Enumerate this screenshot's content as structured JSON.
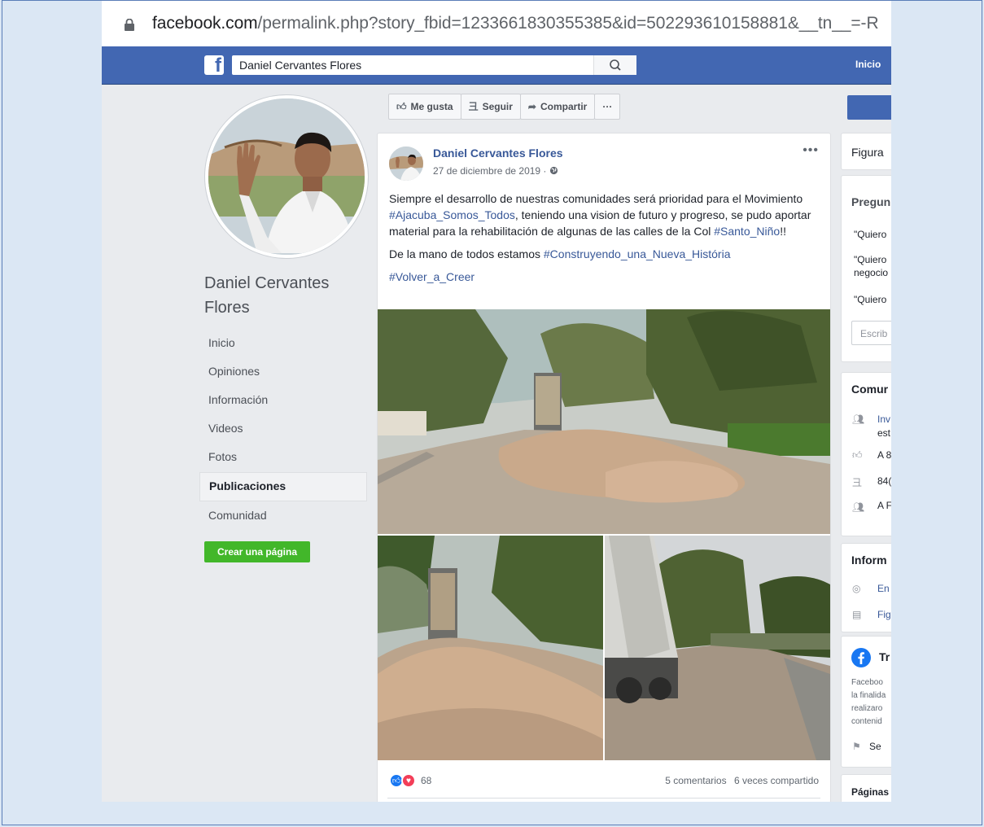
{
  "browser": {
    "url_host": "facebook.com",
    "url_rest": "/permalink.php?story_fbid=1233661830355385&id=502293610158881&__tn__=-R"
  },
  "fb": {
    "search_value": "Daniel Cervantes Flores",
    "nav_home": "Inicio"
  },
  "page": {
    "name": "Daniel Cervantes Flores",
    "nav": [
      "Inicio",
      "Opiniones",
      "Información",
      "Videos",
      "Fotos",
      "Publicaciones",
      "Comunidad"
    ],
    "active_nav": "Publicaciones",
    "create_page": "Crear una página"
  },
  "actions": {
    "like": "Me gusta",
    "follow": "Seguir",
    "share": "Compartir",
    "more": "···"
  },
  "post": {
    "author": "Daniel Cervantes Flores",
    "date": "27 de diciembre de 2019 · ",
    "more": "•••",
    "text1_a": "Siempre el desarrollo de nuestras comunidades será prioridad para el Movimiento ",
    "tag1": "#Ajacuba_Somos_Todos",
    "text1_b": ", teniendo una vision de futuro y progreso, se pudo aportar material para la rehabilitación de algunas de las calles de la Col ",
    "tag2": "#Santo_Niño",
    "text1_c": "!!",
    "text2_a": "De la mano de todos estamos ",
    "tag3": "#Construyendo_una_Nueva_História",
    "tag4": "#Volver_a_Creer",
    "reactions_count": "68",
    "comments": "5 comentarios",
    "shares": "6 veces compartido"
  },
  "sidebar_right": {
    "figura": "Figura",
    "pregun": "Pregun",
    "q1": "\"Quiero",
    "q2a": "\"Quiero",
    "q2b": "negocio",
    "q3": "\"Quiero",
    "write": "Escrib",
    "comun": "Comur",
    "c1a": "Inv",
    "c1b": "est",
    "c2": "A 8",
    "c3": "84(",
    "c4": "A F",
    "inform": "Inform",
    "i1": "En",
    "i2": "Fig",
    "transp": "Tr",
    "t1": "Faceboo",
    "t2": "la finalida",
    "t3": "realizaro",
    "t4": "contenid",
    "t5": "Se",
    "paginas": "Páginas"
  },
  "colors": {
    "fb_blue": "#4267b2",
    "link": "#385898",
    "green": "#42b72a",
    "bg": "#e9ebee"
  }
}
